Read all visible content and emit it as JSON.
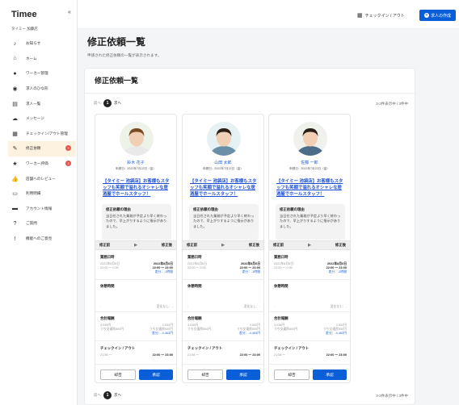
{
  "app": {
    "logo": "Timee",
    "company": "タイミー 加藤店"
  },
  "sidebar": {
    "items": [
      {
        "icon": "bell-icon",
        "glyph": "♪",
        "label": "お知らせ"
      },
      {
        "icon": "home-icon",
        "glyph": "⌂",
        "label": "ホーム"
      },
      {
        "icon": "worker-icon",
        "glyph": "●",
        "label": "ワーカー管理"
      },
      {
        "icon": "job-icon",
        "glyph": "◉",
        "label": "求人のひな形"
      },
      {
        "icon": "list-icon",
        "glyph": "▤",
        "label": "求人一覧"
      },
      {
        "icon": "message-icon",
        "glyph": "☁",
        "label": "メッセージ"
      },
      {
        "icon": "qr-icon",
        "glyph": "▦",
        "label": "チェックイン/アウト管理"
      },
      {
        "icon": "revision-icon",
        "glyph": "✎",
        "label": "修正依頼",
        "badge": "3"
      },
      {
        "icon": "review-icon",
        "glyph": "★",
        "label": "ワーカー評価",
        "badge": "3"
      },
      {
        "icon": "thumb-icon",
        "glyph": "👍",
        "label": "店舗へのレビュー"
      },
      {
        "icon": "document-icon",
        "glyph": "▭",
        "label": "利用明細"
      },
      {
        "icon": "account-icon",
        "glyph": "▬",
        "label": "アカウント情報"
      },
      {
        "icon": "help-icon",
        "glyph": "?",
        "label": "ご質問"
      },
      {
        "icon": "info-icon",
        "glyph": "!",
        "label": "機能へのご意見"
      }
    ]
  },
  "topbar": {
    "checkin": "チェックイン / アウト",
    "post_button": "求人の作成"
  },
  "main": {
    "title": "修正依頼一覧",
    "description": "申請された修正依頼の一覧が表示されます。",
    "section_title": "修正依頼一覧",
    "pager": {
      "prev": "前へ",
      "page": "1",
      "next": "次へ"
    },
    "range": "3-3件表示中 / 3件中"
  },
  "labels": {
    "reason": "修正依頼の理由",
    "before": "修正前",
    "after": "修正後",
    "work_date": "業務日時",
    "break": "休憩時間",
    "total_pay": "合計報酬",
    "checkinout": "チェックイン / アウト",
    "deny": "却否",
    "approve": "承認"
  },
  "workers": [
    {
      "name": "鈴木 花子",
      "date": "申請日：2022年7月22日（金）",
      "job": "【タイミー 池袋店】お客様もスタッフも笑顔で溢れるオシャレな居酒屋でホールスタッフ！",
      "reason": "当日任された業務が予定より早く終わったので、早上がりするように指示がありました。",
      "wd_before": "2022年8月6日\n22:00 〜 0:00",
      "wd_after": "2022年8月6日\n22:00 〜 23:00",
      "wd_diff": "差分：-1時間",
      "break_before": "-",
      "break_after": "変化なし：-",
      "pay_before": "3,036円\nうち交通費500円",
      "pay_after": "2,532円\nうち交通費500円",
      "pay_diff": "差分：-4,463円",
      "ci_before": "21:58 〜",
      "ci_after": "22:00 〜 23:00"
    },
    {
      "name": "山田 太郎",
      "date": "申請日：2022年7月22日（金）",
      "job": "【タイミー 池袋店】お客様もスタッフも笑顔で溢れるオシャレな居酒屋でホールスタッフ！",
      "reason": "当日任された業務が予定より早く終わったので、早上がりするように指示がありました。",
      "wd_before": "2022年8月6日\n22:00 〜 0:00",
      "wd_after": "2022年8月6日\n22:00 〜 23:00",
      "wd_diff": "差分：-1時間",
      "break_before": "-",
      "break_after": "変化なし：-",
      "pay_before": "3,036円\nうち交通費500円",
      "pay_after": "2,532円\nうち交通費500円",
      "pay_diff": "差分：-4,463円",
      "ci_before": "21:58 〜",
      "ci_after": "22:00 〜 23:00"
    },
    {
      "name": "佐藤 一郎",
      "date": "申請日：2022年7月22日（金）",
      "job": "【タイミー 池袋店】お客様もスタッフも笑顔で溢れるオシャレな居酒屋でホールスタッフ！",
      "reason": "当日任された業務が予定より早く終わったので、早上がりするように指示がありました。",
      "wd_before": "2022年8月6日\n22:00 〜 0:00",
      "wd_after": "2022年8月6日\n22:00 〜 23:00",
      "wd_diff": "差分：-1時間",
      "break_before": "-",
      "break_after": "変化なし：-",
      "pay_before": "3,036円\nうち交通費500円",
      "pay_after": "2,532円\nうち交通費500円",
      "pay_diff": "差分：-4,463円",
      "ci_before": "21:58 〜",
      "ci_after": "22:00 〜 23:00"
    }
  ]
}
